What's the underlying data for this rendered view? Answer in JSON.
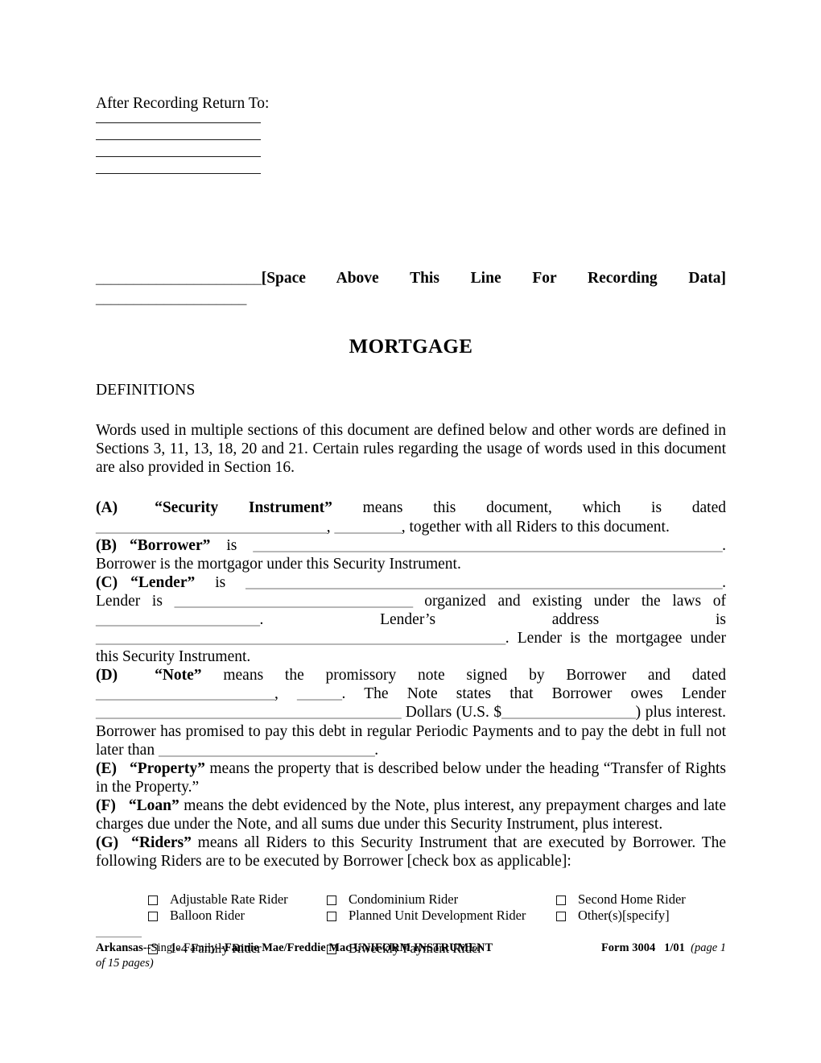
{
  "document": {
    "title": "MORTGAGE",
    "return_to_label": "After Recording Return To:",
    "blank_line_count": 4,
    "recording_data_line": {
      "leading_underscores": "______________________",
      "text": "[Space Above This Line For Recording Data]",
      "second_line_underscores": "____________________"
    },
    "definitions_heading": "DEFINITIONS",
    "intro_paragraph": "Words used in multiple sections of this document are defined below and other words are defined in Sections 3, 11, 13, 18, 20 and 21.  Certain rules regarding the usage of words used in this document are also provided in Section 16.",
    "sections": {
      "a": {
        "letter": "(A)",
        "term": "“Security Instrument”",
        "text_1": "means this document, which is dated",
        "blank_1": "_______________________________",
        "sep_1": ", ",
        "blank_2": "_________",
        "text_2": ", together with all Riders to this document."
      },
      "b": {
        "letter": "(B)",
        "term": "“Borrower”",
        "text_1": "is",
        "blank_1": "_______________________________________________________________",
        "text_2": ".  Borrower is the mortgagor under this Security Instrument."
      },
      "c": {
        "letter": "(C)",
        "term": "“Lender”",
        "text_1": "is",
        "blank_1": "________________________________________________________________",
        "text_2": ".  Lender is",
        "blank_2": "________________________________",
        "text_3": "organized and existing under the laws of",
        "blank_3": "______________________",
        "text_4": ".  Lender’s address is",
        "blank_4": "_______________________________________________________",
        "text_5": ".  Lender is the mortgagee under this Security Instrument."
      },
      "d": {
        "letter": "(D)",
        "term": "“Note”",
        "text_1": "means the promissory note signed by Borrower and dated",
        "blank_1": "________________________",
        "sep_1": ", ",
        "blank_2": "______",
        "text_2": ".  The Note states that Borrower owes Lender",
        "blank_3": "_________________________________________",
        "text_3": "Dollars (U.S. $",
        "blank_4": "__________________",
        "text_4": ") plus interest.  Borrower has promised to pay this debt in regular Periodic Payments and to pay the debt in full not later than",
        "blank_5": "_____________________________",
        "text_5": "."
      },
      "e": {
        "letter": "(E)",
        "term": "“Property”",
        "text_1": "means the property that is described below under the heading “Transfer of Rights in the Property.”"
      },
      "f": {
        "letter": "(F)",
        "term": "“Loan”",
        "text_1": "means the debt evidenced by the Note, plus interest, any prepayment charges and late charges due under the Note, and all sums due under this Security Instrument, plus interest."
      },
      "g": {
        "letter": "(G)",
        "term": "“Riders”",
        "text_1": "means all Riders to this Security Instrument that are executed by Borrower.  The following Riders are to be executed by Borrower [check box as applicable]:"
      }
    },
    "riders": {
      "row1": [
        {
          "label": "Adjustable Rate Rider",
          "checked": false
        },
        {
          "label": "Condominium Rider",
          "checked": false
        },
        {
          "label": "Second Home Rider",
          "checked": false
        }
      ],
      "row2": [
        {
          "label": "Balloon Rider",
          "checked": false
        },
        {
          "label": "Planned Unit Development Rider",
          "checked": false
        },
        {
          "label": "Other(s)[specify]",
          "checked": false
        }
      ],
      "row3": [
        {
          "label": "1-4 Family Rider",
          "checked": false
        },
        {
          "label": "Biweekly Payment Rider",
          "checked": false
        }
      ]
    },
    "footer": {
      "state": "Arkansas--",
      "family": "Single Family--",
      "agency": "Fannie Mae/Freddie Mac UNIFORM INSTRUMENT",
      "form": "Form 3004",
      "version": "1/01",
      "page_info": "(page 1",
      "page_info_2": "of 15 pages)"
    }
  }
}
